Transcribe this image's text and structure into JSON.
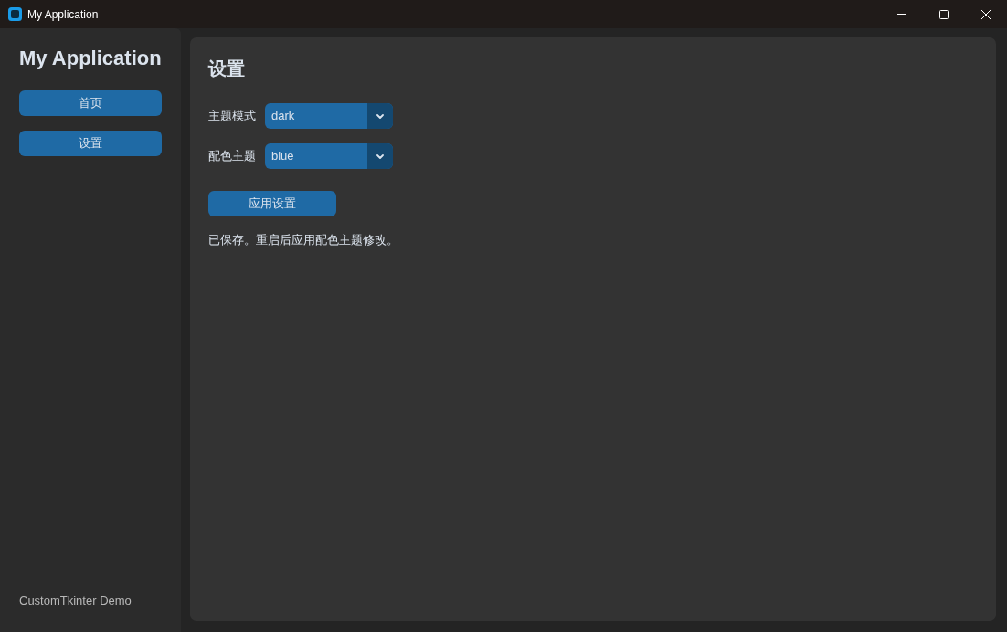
{
  "window": {
    "title": "My Application"
  },
  "sidebar": {
    "title": "My Application",
    "nav": [
      "首页",
      "设置"
    ],
    "footer": "CustomTkinter Demo"
  },
  "main": {
    "heading": "设置",
    "fields": [
      {
        "label": "主题模式",
        "value": "dark"
      },
      {
        "label": "配色主题",
        "value": "blue"
      }
    ],
    "apply_button": "应用设置",
    "status": "已保存。重启后应用配色主题修改。"
  }
}
